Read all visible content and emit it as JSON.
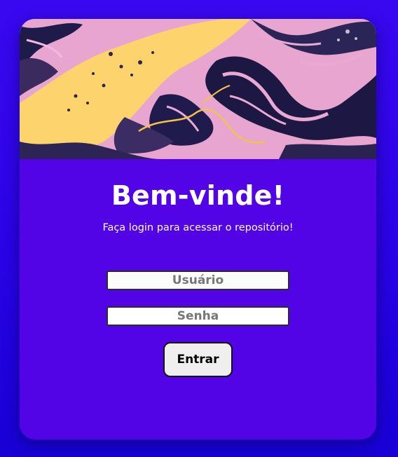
{
  "login": {
    "title": "Bem-vinde!",
    "subtitle": "Faça login para acessar o repositório!",
    "username_placeholder": "Usuário",
    "password_placeholder": "Senha",
    "submit_label": "Entrar"
  },
  "colors": {
    "page_background": "#2a03e6",
    "card_background": "#5204e6",
    "banner_pink": "#e9a7d2",
    "banner_yellow": "#fdd36e",
    "banner_navy": "#1a1740"
  }
}
